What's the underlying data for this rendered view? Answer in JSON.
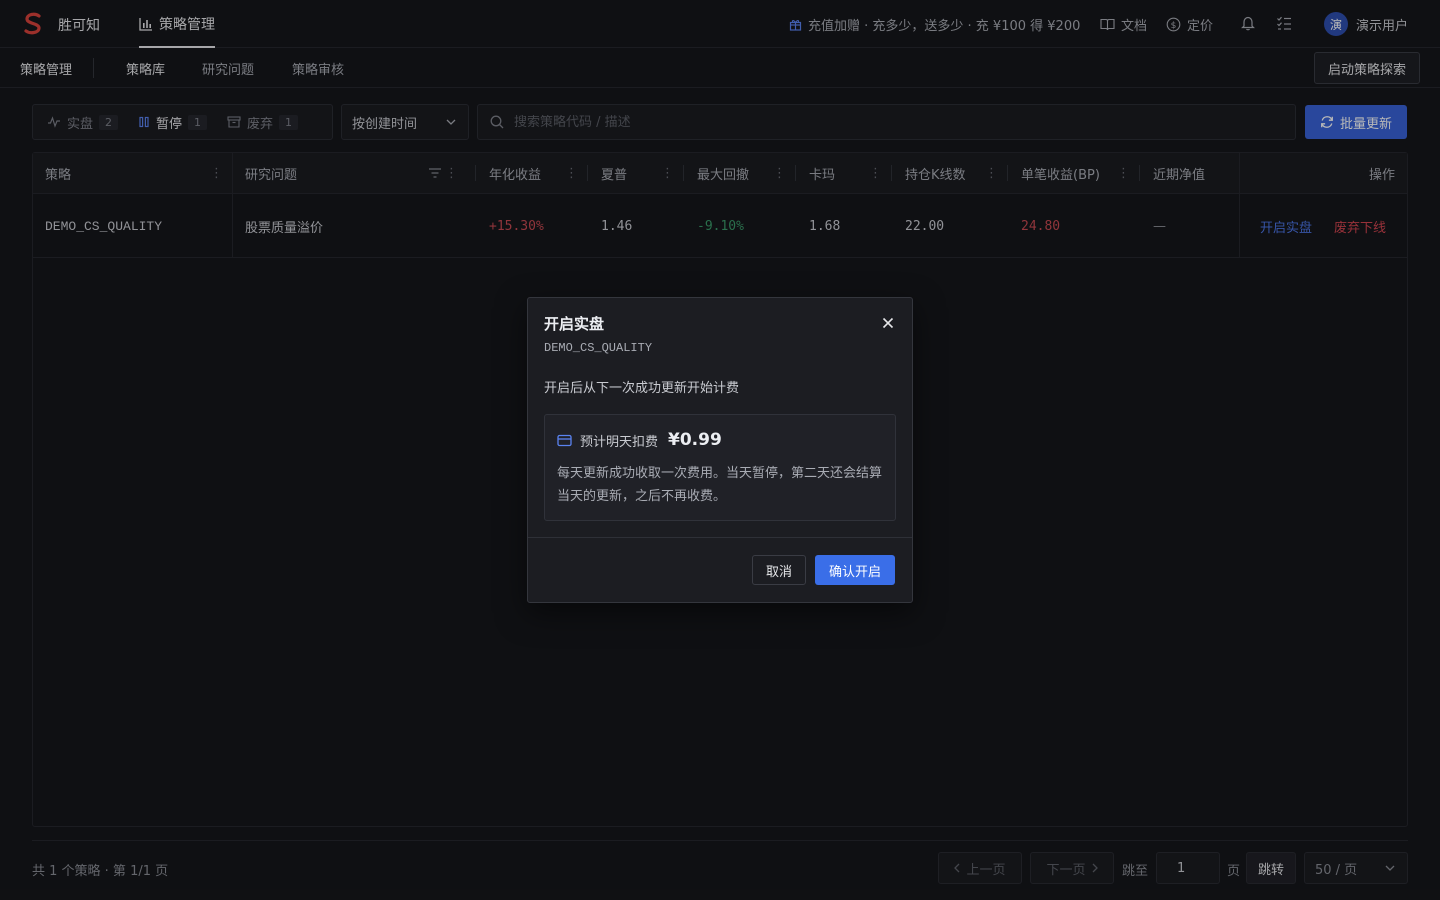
{
  "header": {
    "brand": "胜可知",
    "nav_active": "策略管理",
    "promo": "充值加赠 · 充多少，送多少 · 充 ¥100 得 ¥200",
    "docs": "文档",
    "pricing": "定价",
    "avatar_char": "演",
    "username": "演示用户"
  },
  "subnav": {
    "title": "策略管理",
    "tabs": [
      "策略库",
      "研究问题",
      "策略审核"
    ],
    "explore_button": "启动策略探索"
  },
  "filters": {
    "segments": [
      {
        "label": "实盘",
        "count": "2"
      },
      {
        "label": "暂停",
        "count": "1"
      },
      {
        "label": "废弃",
        "count": "1"
      }
    ],
    "sort_value": "按创建时间",
    "search_placeholder": "搜索策略代码 / 描述",
    "batch_button": "批量更新"
  },
  "table": {
    "columns": [
      "策略",
      "研究问题",
      "年化收益",
      "夏普",
      "最大回撤",
      "卡玛",
      "持仓K线数",
      "单笔收益(BP)",
      "近期净值",
      "操作"
    ],
    "rows": [
      {
        "strategy": "DEMO_CS_QUALITY",
        "question": "股票质量溢价",
        "annual_return": "+15.30%",
        "sharpe": "1.46",
        "max_drawdown": "-9.10%",
        "calmar": "1.68",
        "holding_bars": "22.00",
        "per_trade_bp": "24.80",
        "recent_nav": "—",
        "action_live": "开启实盘",
        "action_drop": "废弃下线"
      }
    ]
  },
  "footer": {
    "summary": "共 1 个策略 · 第 1/1 页",
    "prev": "上一页",
    "next": "下一页",
    "jump_label": "跳至",
    "jump_value": "1",
    "page_unit": "页",
    "go": "跳转",
    "page_size": "50 / 页"
  },
  "modal": {
    "title": "开启实盘",
    "code": "DEMO_CS_QUALITY",
    "description": "开启后从下一次成功更新开始计费",
    "fee_label": "预计明天扣费",
    "fee_value": "¥0.99",
    "fee_note": "每天更新成功收取一次费用。当天暂停，第二天还会结算当天的更新，之后不再收费。",
    "cancel": "取消",
    "confirm": "确认开启"
  },
  "colors": {
    "accent": "#3a6ee8",
    "positive": "#c84a52",
    "negative": "#3b9a6a",
    "danger": "#d24550"
  }
}
